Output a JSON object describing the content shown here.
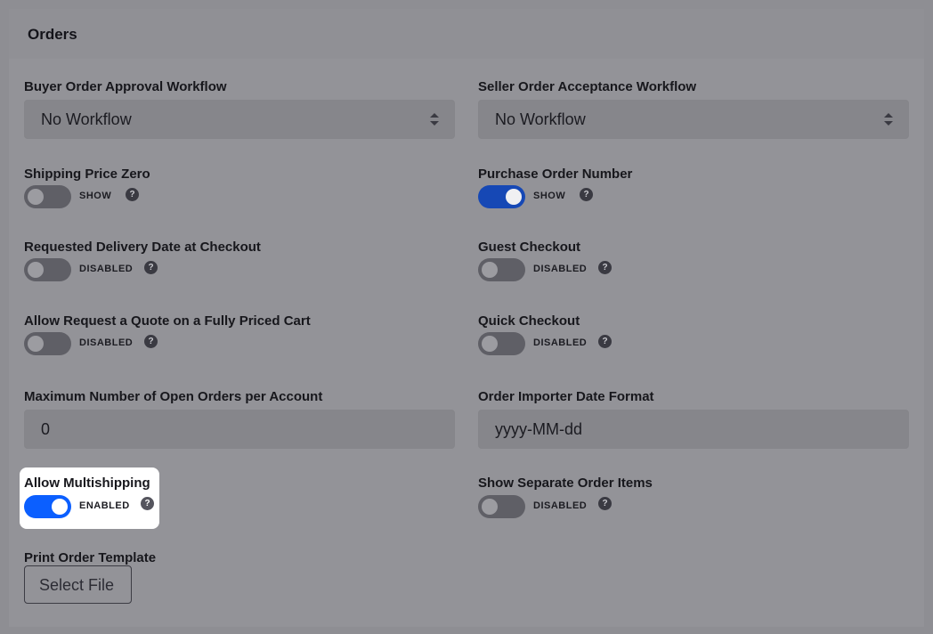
{
  "section": {
    "title": "Orders"
  },
  "fields": {
    "buyer_workflow": {
      "label": "Buyer Order Approval Workflow",
      "value": "No Workflow"
    },
    "seller_workflow": {
      "label": "Seller Order Acceptance Workflow",
      "value": "No Workflow"
    },
    "shipping_zero": {
      "label": "Shipping Price Zero",
      "state": "SHOW",
      "on": false
    },
    "po_number": {
      "label": "Purchase Order Number",
      "state": "SHOW",
      "on": true
    },
    "delivery_date": {
      "label": "Requested Delivery Date at Checkout",
      "state": "DISABLED",
      "on": false
    },
    "guest_checkout": {
      "label": "Guest Checkout",
      "state": "DISABLED",
      "on": false
    },
    "quote_cart": {
      "label": "Allow Request a Quote on a Fully Priced Cart",
      "state": "DISABLED",
      "on": false
    },
    "quick_checkout": {
      "label": "Quick Checkout",
      "state": "DISABLED",
      "on": false
    },
    "max_orders": {
      "label": "Maximum Number of Open Orders per Account",
      "value": "0"
    },
    "date_format": {
      "label": "Order Importer Date Format",
      "value": "yyyy-MM-dd"
    },
    "multishipping": {
      "label": "Allow Multishipping",
      "state": "ENABLED",
      "on": true
    },
    "separate_items": {
      "label": "Show Separate Order Items",
      "state": "DISABLED",
      "on": false
    },
    "print_template": {
      "label": "Print Order Template",
      "button": "Select File"
    }
  },
  "help_glyph": "?",
  "icons": {
    "help": "question-circle-icon",
    "select_arrows": "sort-arrows-icon"
  },
  "colors": {
    "accent": "#0b5fff",
    "overlay": "#939398"
  }
}
